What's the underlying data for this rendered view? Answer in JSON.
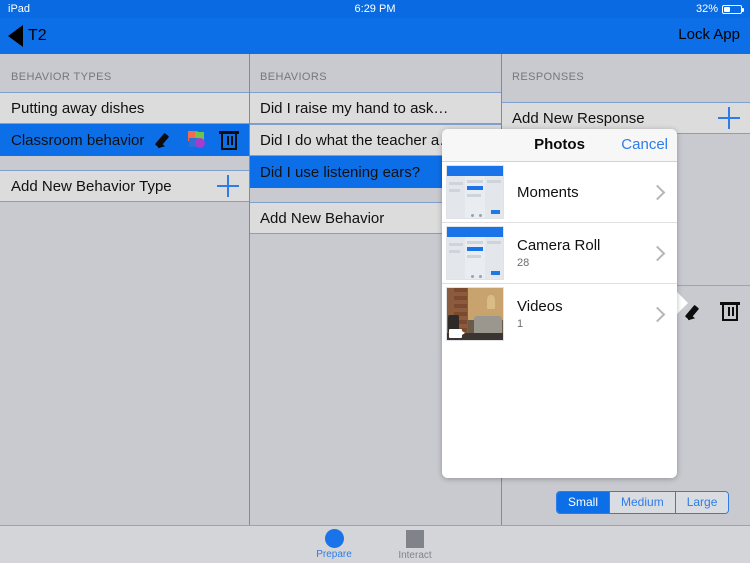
{
  "status_bar": {
    "device": "iPad",
    "time": "6:29 PM",
    "battery_percent": "32%"
  },
  "nav_bar": {
    "back_label": "T2",
    "lock_app_label": "Lock App"
  },
  "columns": {
    "behavior_types": {
      "header": "BEHAVIOR TYPES",
      "items": [
        {
          "label": "Putting away dishes",
          "selected": false
        },
        {
          "label": "Classroom behavior",
          "selected": true
        }
      ],
      "add_label": "Add New Behavior Type"
    },
    "behaviors": {
      "header": "BEHAVIORS",
      "items": [
        {
          "label": "Did I raise my hand to ask…",
          "selected": false
        },
        {
          "label": "Did I do what the teacher a…",
          "selected": false
        },
        {
          "label": "Did I use listening ears?",
          "selected": true
        }
      ],
      "add_label": "Add New Behavior"
    },
    "responses": {
      "header": "RESPONSES",
      "add_label": "Add New Response"
    }
  },
  "popover": {
    "title": "Photos",
    "cancel_label": "Cancel",
    "albums": [
      {
        "name": "Moments",
        "count": "",
        "kind": "app-screenshot"
      },
      {
        "name": "Camera Roll",
        "count": "28",
        "kind": "app-screenshot"
      },
      {
        "name": "Videos",
        "count": "1",
        "kind": "video"
      }
    ]
  },
  "size_control": {
    "options": [
      "Small",
      "Medium",
      "Large"
    ],
    "selected": "Small"
  },
  "tab_bar": {
    "tabs": [
      {
        "label": "Prepare",
        "active": true
      },
      {
        "label": "Interact",
        "active": false
      }
    ]
  },
  "colors": {
    "accent_blue": "#0d6fe8",
    "link_blue": "#2f7ce8",
    "panel_gray": "#c8cad0",
    "row_gray": "#dcdcdc"
  }
}
